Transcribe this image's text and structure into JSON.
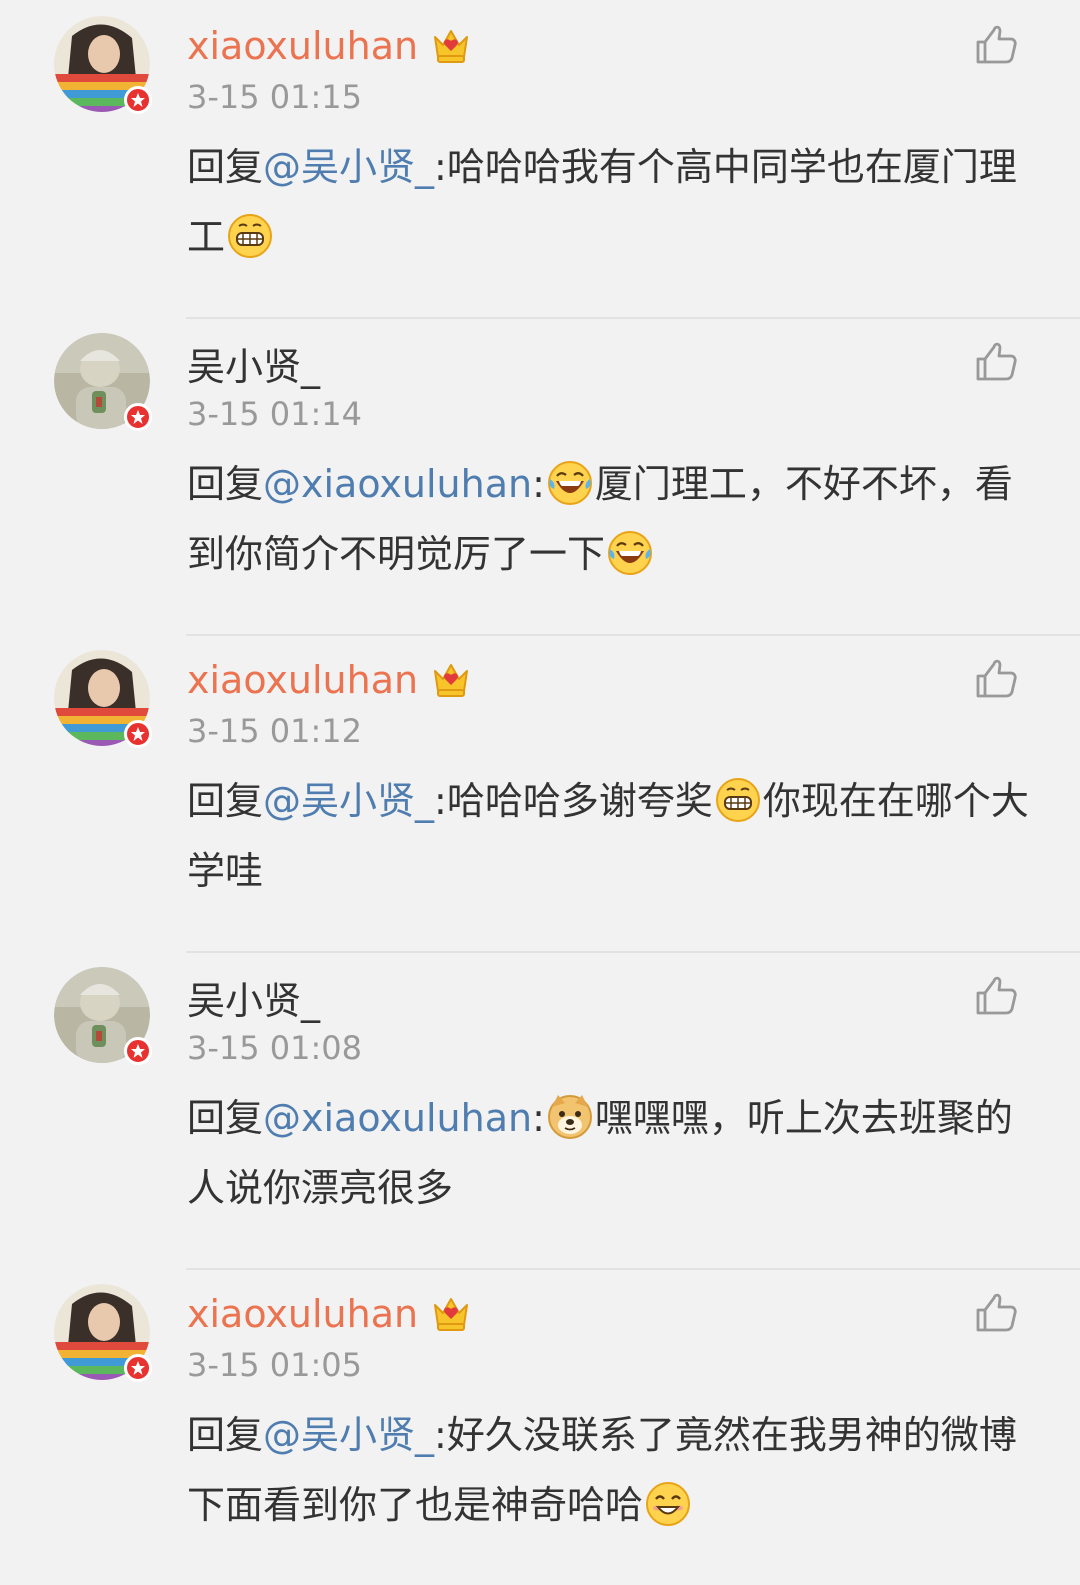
{
  "colors": {
    "background": "#f2f2f2",
    "vip_name": "#eb7350",
    "mention": "#507daf",
    "timestamp": "#999999",
    "text": "#333333",
    "badge": "#e8322f"
  },
  "comments": [
    {
      "username": "xiaoxuluhan",
      "vip": true,
      "badge_icon": "crown-icon",
      "timestamp": "3-15 01:15",
      "reply_prefix": "回复",
      "mention": "@吴小贤_",
      "colon": ":",
      "text1": "哈哈哈我有个高中同学也在厦门理工",
      "emoji1": "grin-emoji",
      "text2": "",
      "emoji2": "",
      "text3": ""
    },
    {
      "username": "吴小贤_",
      "vip": false,
      "timestamp": "3-15 01:14",
      "reply_prefix": "回复",
      "mention": "@xiaoxuluhan",
      "colon": ":",
      "text1": "",
      "emoji1": "laugh-cry-emoji",
      "text2": "厦门理工，不好不坏，看到你简介不明觉厉了一下",
      "emoji2": "laugh-cry-emoji",
      "text3": ""
    },
    {
      "username": "xiaoxuluhan",
      "vip": true,
      "badge_icon": "crown-icon",
      "timestamp": "3-15 01:12",
      "reply_prefix": "回复",
      "mention": "@吴小贤_",
      "colon": ":",
      "text1": "哈哈哈多谢夸奖",
      "emoji1": "grin-emoji",
      "text2": "你现在在哪个大学哇",
      "emoji2": "",
      "text3": ""
    },
    {
      "username": "吴小贤_",
      "vip": false,
      "timestamp": "3-15 01:08",
      "reply_prefix": "回复",
      "mention": "@xiaoxuluhan",
      "colon": ":",
      "text1": "",
      "emoji1": "doge-emoji",
      "text2": "嘿嘿嘿，听上次去班聚的人说你漂亮很多",
      "emoji2": "",
      "text3": ""
    },
    {
      "username": "xiaoxuluhan",
      "vip": true,
      "badge_icon": "crown-icon",
      "timestamp": "3-15 01:05",
      "reply_prefix": "回复",
      "mention": "@吴小贤_",
      "colon": ":",
      "text1": "好久没联系了竟然在我男神的微博下面看到你了也是神奇哈哈",
      "emoji1": "smile-emoji",
      "text2": "",
      "emoji2": "",
      "text3": ""
    }
  ]
}
